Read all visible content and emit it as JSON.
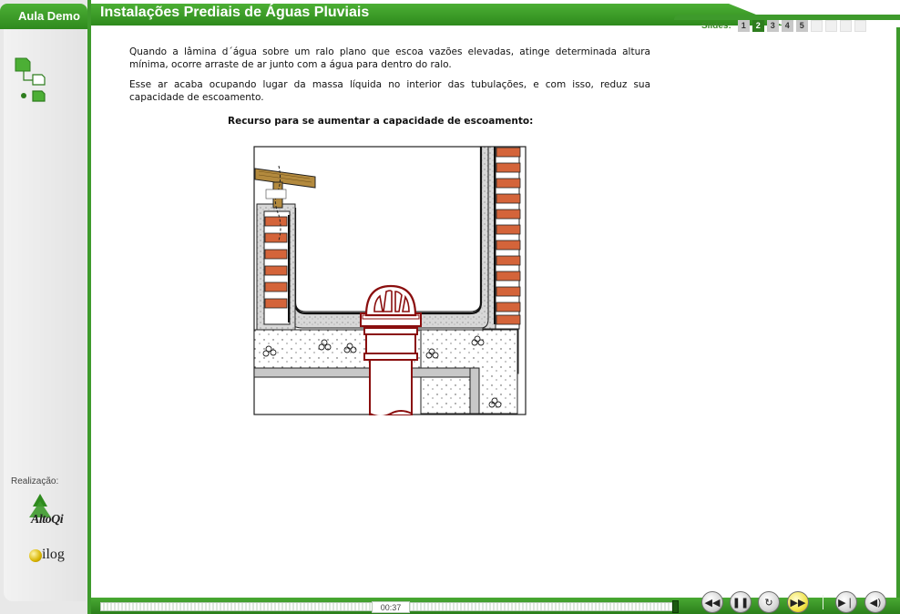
{
  "sidebar": {
    "tab_label": "Aula Demo",
    "realizacao_label": "Realização:",
    "logo_altoqi_text": "AltoQi",
    "logo_ilog_text": "ilog"
  },
  "header": {
    "title": "Instalações Prediais de Águas Pluviais"
  },
  "slides": {
    "label": "Slides:",
    "numbers": [
      "1",
      "2",
      "3",
      "4",
      "5"
    ],
    "active_index": 1
  },
  "content": {
    "paragraph_1": "Quando a lâmina d´água sobre um ralo plano que escoa vazões elevadas, atinge determinada altura mínima, ocorre arraste de ar junto com a água para dentro do ralo.",
    "paragraph_2": "Esse ar acaba ocupando lugar da massa líquida no interior das tubulações, e com isso, reduz sua capacidade de escoamento.",
    "caption": "Recurso para se aumentar a capacidade de escoamento:"
  },
  "player": {
    "time": "00:37",
    "progress_fraction": 0.99
  },
  "colors": {
    "brand_green": "#3e9a2c",
    "brick": "#d4643a",
    "pipe_red": "#8a0e0e"
  },
  "icons": [
    "rewind-icon",
    "pause-icon",
    "replay-icon",
    "fast-forward-icon",
    "next-icon",
    "volume-icon"
  ]
}
